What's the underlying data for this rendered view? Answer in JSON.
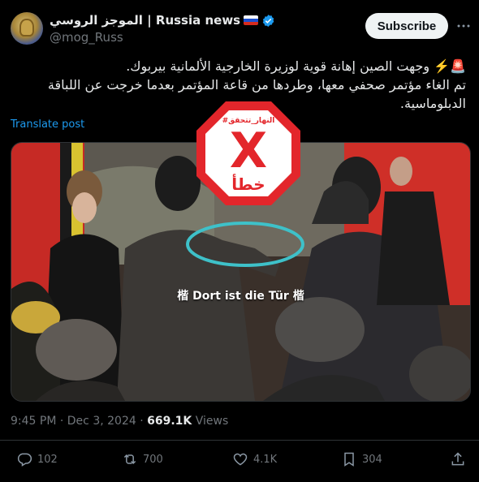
{
  "header": {
    "display_name": "الموجز الروسي | Russia news",
    "handle": "@mog_Russ",
    "subscribe_label": "Subscribe",
    "flag_icon": "russia-flag-icon",
    "verified_icon": "verified-badge-icon"
  },
  "tweet": {
    "line1": "🚨⚡️ وجهت الصين إهانة قوية لوزيرة الخارجية الألمانية بيربوك.",
    "line2": "تم الغاء مؤتمر صحفي معها، وطردها من قاعة المؤتمر بعدما خرجت عن اللباقة الدبلوماسية.",
    "translate_label": "Translate post"
  },
  "media": {
    "caption": "楷 Dort ist die Tür 楷",
    "badge_header": "#النهار_تتحقق",
    "badge_mark": "X",
    "badge_word": "خطأ"
  },
  "meta": {
    "time": "9:45 PM",
    "separator": " · ",
    "date": "Dec 3, 2024",
    "views_count": "669.1K",
    "views_label": " Views"
  },
  "actions": {
    "replies": "102",
    "reposts": "700",
    "likes": "4.1K",
    "bookmarks": "304"
  },
  "colors": {
    "accent": "#1d9bf0",
    "badge_red": "#e3262b",
    "circle_highlight": "#3ec1c9"
  }
}
